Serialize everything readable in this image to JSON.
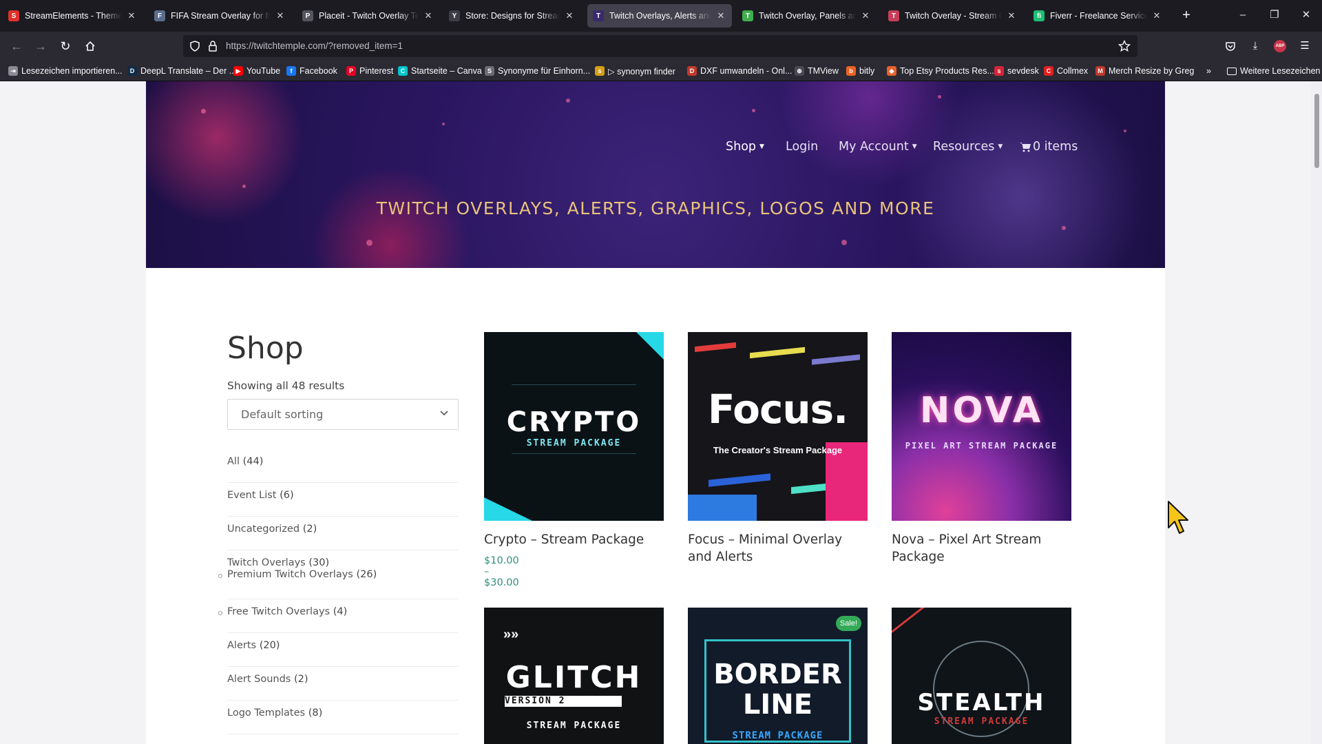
{
  "browser": {
    "tabs": [
      {
        "label": "StreamElements - Themes gal",
        "fav_color": "#e0312b",
        "fav_char": "S"
      },
      {
        "label": "FIFA Stream Overlay for free, c",
        "fav_color": "#5a6d8c",
        "fav_char": "F"
      },
      {
        "label": "Placeit - Twitch Overlay Temp",
        "fav_color": "#555560",
        "fav_char": "P"
      },
      {
        "label": "Store: Designs for Streamers a",
        "fav_color": "#3d3d46",
        "fav_char": "Y"
      },
      {
        "label": "Twitch Overlays, Alerts and G",
        "fav_color": "#3a2a6e",
        "fav_char": "T"
      },
      {
        "label": "Twitch Overlay, Panels and Yo",
        "fav_color": "#3fae4c",
        "fav_char": "T"
      },
      {
        "label": "Twitch Overlay - Stream Overl",
        "fav_color": "#c83e5a",
        "fav_char": "T"
      },
      {
        "label": "Fiverr - Freelance Services Ma",
        "fav_color": "#1dbf73",
        "fav_char": "fi"
      }
    ],
    "active_tab_index": 4,
    "url": "https://twitchtemple.com/?removed_item=1",
    "bookmarks": [
      {
        "label": "Lesezeichen importieren...",
        "color": "#8a8a94",
        "char": "⇥"
      },
      {
        "label": "DeepL Translate – Der ...",
        "color": "#0f2b46",
        "char": "D"
      },
      {
        "label": "YouTube",
        "color": "#ff0000",
        "char": "▶"
      },
      {
        "label": "Facebook",
        "color": "#1877f2",
        "char": "f"
      },
      {
        "label": "Pinterest",
        "color": "#e60023",
        "char": "P"
      },
      {
        "label": "Startseite – Canva",
        "color": "#00c4cc",
        "char": "C"
      },
      {
        "label": "Synonyme für Einhorn...",
        "color": "#6b6b74",
        "char": "S"
      },
      {
        "label": "▷ synonym finder",
        "color": "#d4a017",
        "char": "s"
      },
      {
        "label": "DXF umwandeln - Onl...",
        "color": "#c0392b",
        "char": "D"
      },
      {
        "label": "TMView",
        "color": "#4a4a55",
        "char": "⊕"
      },
      {
        "label": "bitly",
        "color": "#ee6123",
        "char": "b"
      },
      {
        "label": "Top Etsy Products Res...",
        "color": "#e8632b",
        "char": "◆"
      },
      {
        "label": "sevdesk",
        "color": "#d6253a",
        "char": "s"
      },
      {
        "label": "Collmex",
        "color": "#e02020",
        "char": "C"
      },
      {
        "label": "Merch Resize by Greg",
        "color": "#c0392b",
        "char": "M"
      }
    ],
    "more_bookmarks": "Weitere Lesezeichen"
  },
  "site": {
    "nav": {
      "shop": "Shop",
      "login": "Login",
      "account": "My Account",
      "resources": "Resources",
      "cart": "0 items"
    },
    "tagline": "TWITCH OVERLAYS, ALERTS, GRAPHICS, LOGOS AND MORE"
  },
  "shop": {
    "title": "Shop",
    "results": "Showing all 48 results",
    "sorting": "Default sorting",
    "categories": [
      {
        "name": "All",
        "count": "(44)"
      },
      {
        "name": "Event List",
        "count": "(6)"
      },
      {
        "name": "Uncategorized",
        "count": "(2)"
      },
      {
        "name": "Twitch Overlays",
        "count": "(30)"
      },
      {
        "name": "Premium Twitch Overlays",
        "count": "(26)"
      },
      {
        "name": "Free Twitch Overlays",
        "count": "(4)"
      },
      {
        "name": "Alerts",
        "count": "(20)"
      },
      {
        "name": "Alert Sounds",
        "count": "(2)"
      },
      {
        "name": "Logo Templates",
        "count": "(8)"
      }
    ],
    "products": [
      {
        "name": "Crypto – Stream Package",
        "price": "$10.00 – $30.00",
        "art_title": "CRYPTO",
        "art_sub": "STREAM PACKAGE"
      },
      {
        "name": "Focus – Minimal Overlay and Alerts",
        "price": "",
        "art_title": "Focus.",
        "art_sub": "The Creator's Stream Package"
      },
      {
        "name": "Nova – Pixel Art Stream Package",
        "price": "",
        "art_title": "NOVA",
        "art_sub": "PIXEL ART STREAM PACKAGE"
      },
      {
        "name": "",
        "price": "",
        "art_title": "GLITCH",
        "art_sub": "VERSION 2",
        "art_sub2": "STREAM PACKAGE"
      },
      {
        "name": "",
        "price": "",
        "art_title": "BORDER",
        "art_title2": "LINE",
        "art_sub": "STREAM PACKAGE",
        "badge": "Sale!"
      },
      {
        "name": "",
        "price": "",
        "art_title": "STEALTH",
        "art_sub": "STREAM PACKAGE"
      }
    ]
  },
  "colors": {
    "accent_price": "#2f8f7a",
    "tagline": "#e8c27b",
    "sale_badge": "#33aa58"
  }
}
